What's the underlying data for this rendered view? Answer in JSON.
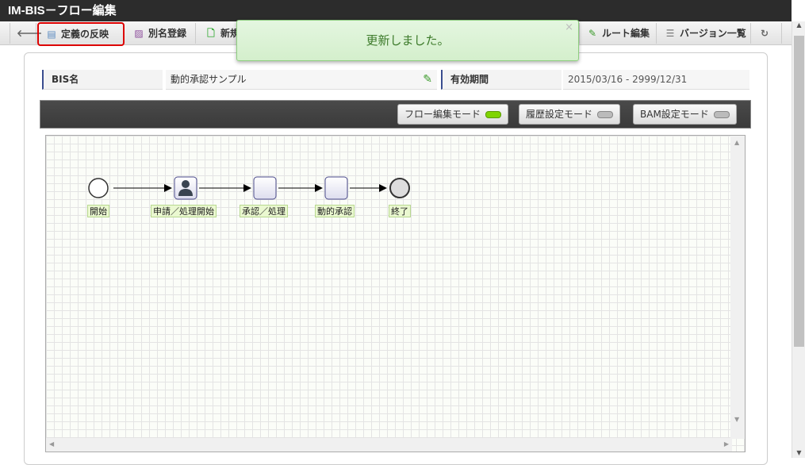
{
  "window": {
    "title": "IM-BIS－フロー編集"
  },
  "toolbar": {
    "apply": "定義の反映",
    "alias": "別名登録",
    "new": "新規",
    "route": "ルート編集",
    "versions": "バージョン一覧"
  },
  "toast": {
    "message": "更新しました。",
    "close": "×"
  },
  "info": {
    "bis_name_label": "BIS名",
    "bis_name_value": "動的承認サンプル",
    "period_label": "有効期間",
    "period_value": "2015/03/16  -  2999/12/31"
  },
  "modes": [
    {
      "label": "フロー編集モード",
      "active": true
    },
    {
      "label": "履歴設定モード",
      "active": false
    },
    {
      "label": "BAM設定モード",
      "active": false
    }
  ],
  "flow": {
    "nodes": [
      {
        "label": "開始",
        "type": "start"
      },
      {
        "label": "申請／処理開始",
        "type": "user-task"
      },
      {
        "label": "承認／処理",
        "type": "task"
      },
      {
        "label": "動的承認",
        "type": "task"
      },
      {
        "label": "終了",
        "type": "end"
      }
    ]
  },
  "colors": {
    "titlebar": "#2c2c2c",
    "highlight": "#dd0000",
    "toast_bg": "#d4efcc",
    "led_on": "#7fd400"
  }
}
